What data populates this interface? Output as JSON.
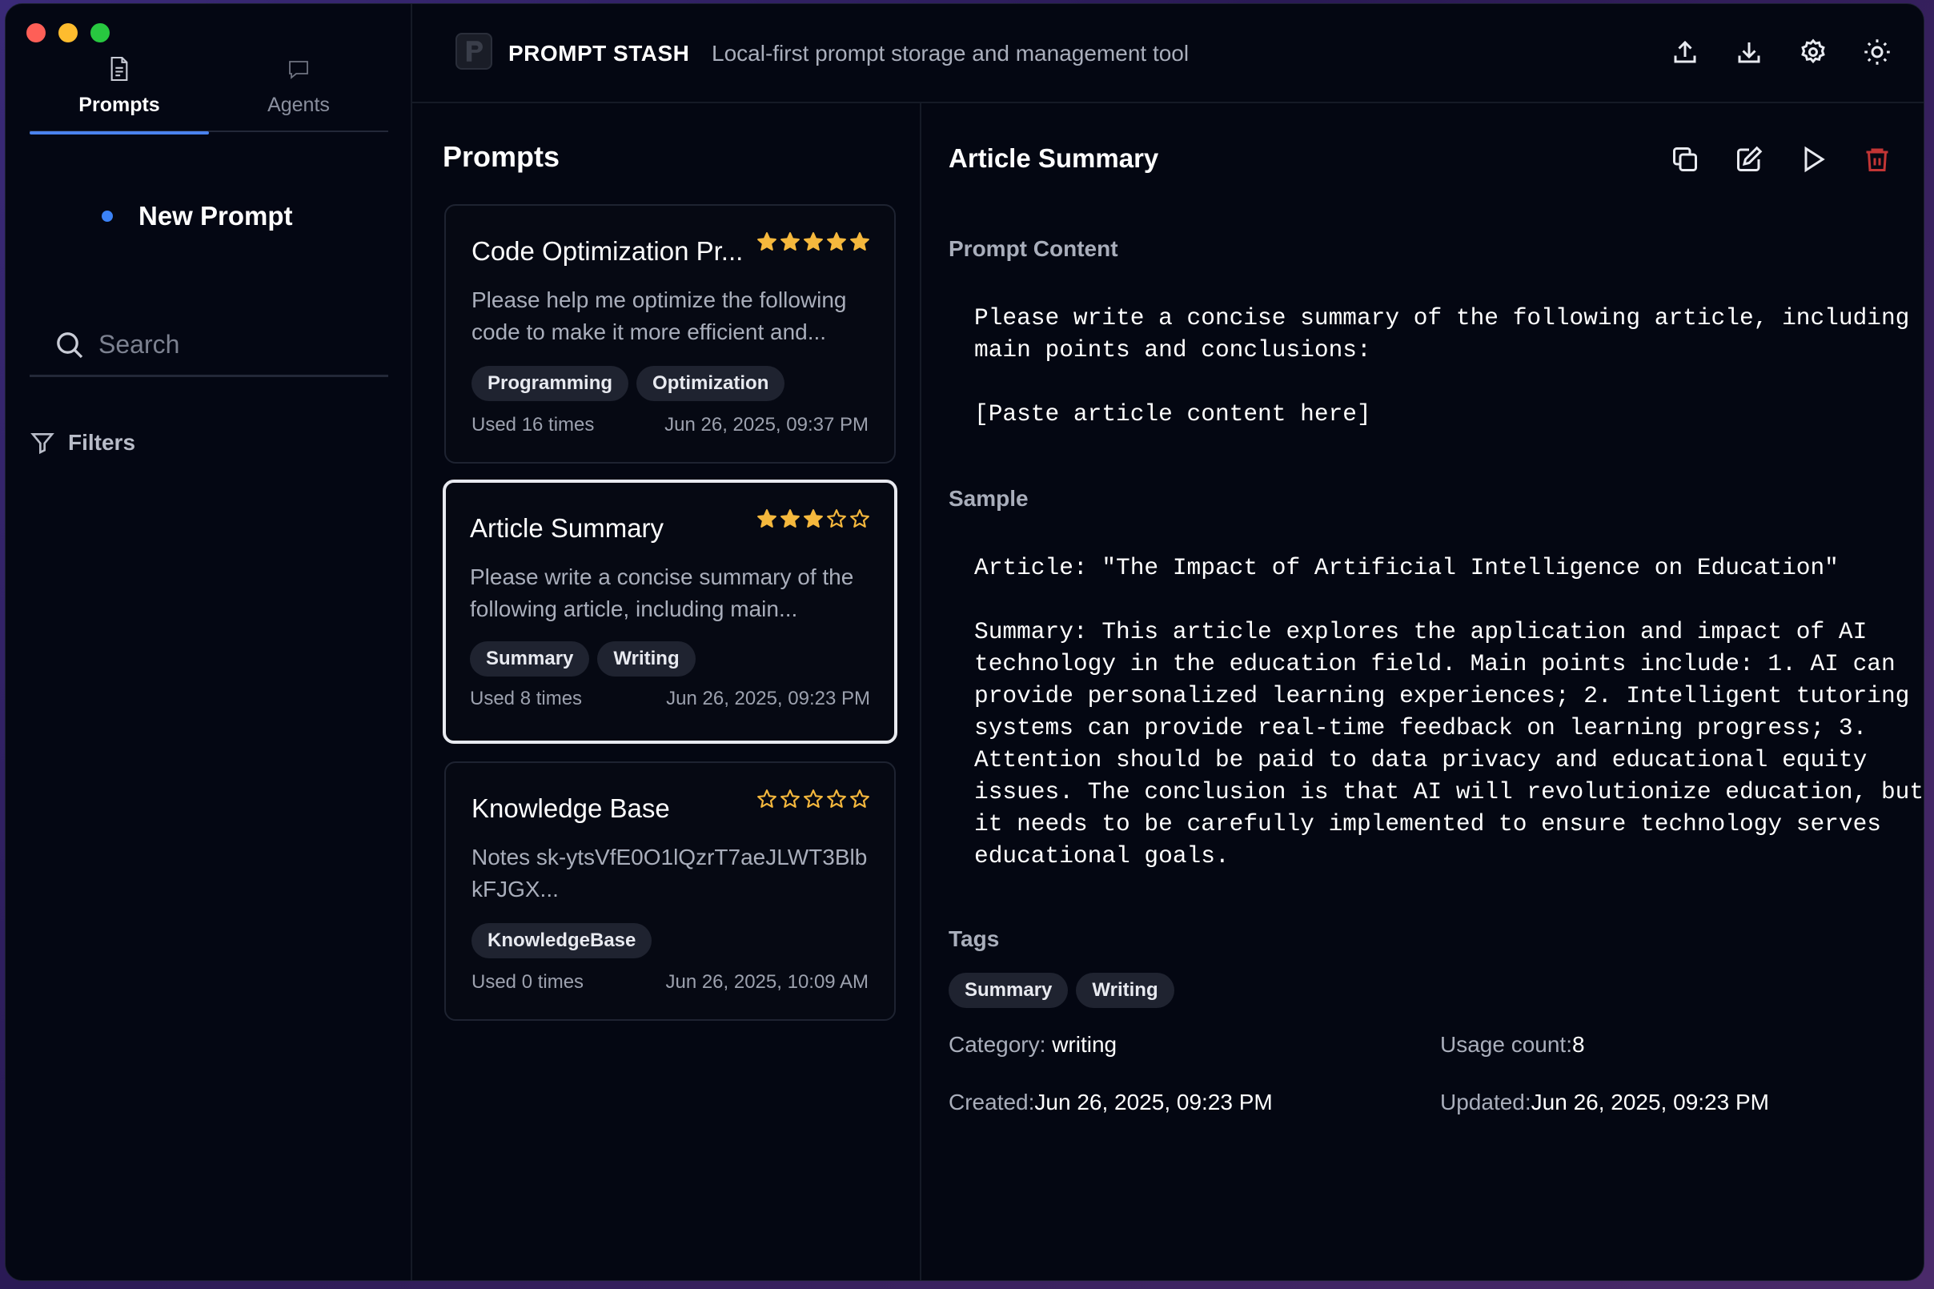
{
  "app": {
    "title": "PROMPT STASH",
    "subtitle": "Local-first prompt storage and management tool",
    "logo_letter": "P"
  },
  "sidebar": {
    "tabs": [
      {
        "label": "Prompts",
        "icon": "document-icon",
        "active": true
      },
      {
        "label": "Agents",
        "icon": "chat-bubble-icon",
        "active": false
      }
    ],
    "new_prompt_label": "New Prompt",
    "search_placeholder": "Search",
    "filters_label": "Filters"
  },
  "header_actions": [
    "upload-icon",
    "download-icon",
    "gear-icon",
    "sun-icon"
  ],
  "list": {
    "title": "Prompts",
    "cards": [
      {
        "title": "Code Optimization Pr...",
        "rating": 5,
        "description": "Please help me optimize the following code to make it more efficient and...",
        "tags": [
          "Programming",
          "Optimization"
        ],
        "used": "Used 16 times",
        "date": "Jun 26, 2025, 09:37 PM",
        "selected": false
      },
      {
        "title": "Article Summary",
        "rating": 3,
        "description": "Please write a concise summary of the following article, including main...",
        "tags": [
          "Summary",
          "Writing"
        ],
        "used": "Used 8 times",
        "date": "Jun 26, 2025, 09:23 PM",
        "selected": true
      },
      {
        "title": "Knowledge Base",
        "rating": 0,
        "description": "Notes sk-ytsVfE0O1lQzrT7aeJLWT3BlbkFJGX...",
        "tags": [
          "KnowledgeBase"
        ],
        "used": "Used 0 times",
        "date": "Jun 26, 2025, 10:09 AM",
        "selected": false
      }
    ]
  },
  "detail": {
    "title": "Article Summary",
    "actions": [
      "copy-icon",
      "edit-icon",
      "play-icon",
      "trash-icon"
    ],
    "content_label": "Prompt Content",
    "content": "Please write a concise summary of the following article, including main points and conclusions:\n\n[Paste article content here]",
    "sample_label": "Sample",
    "sample": "Article: \"The Impact of Artificial Intelligence on Education\"\n\nSummary: This article explores the application and impact of AI technology in the education field. Main points include: 1. AI can provide personalized learning experiences; 2. Intelligent tutoring systems can provide real-time feedback on learning progress; 3. Attention should be paid to data privacy and educational equity issues. The conclusion is that AI will revolutionize education, but it needs to be carefully implemented to ensure technology serves educational goals.",
    "tags_label": "Tags",
    "tags": [
      "Summary",
      "Writing"
    ],
    "category_key": "Category:",
    "category_value": "writing",
    "usage_key": "Usage count:",
    "usage_value": "8",
    "created_key": "Created:",
    "created_value": "Jun 26, 2025, 09:23 PM",
    "updated_key": "Updated:",
    "updated_value": "Jun 26, 2025, 09:23 PM"
  },
  "colors": {
    "accent": "#4a82ee",
    "star": "#f5b83d",
    "danger": "#d03a3a",
    "background": "#040712"
  }
}
